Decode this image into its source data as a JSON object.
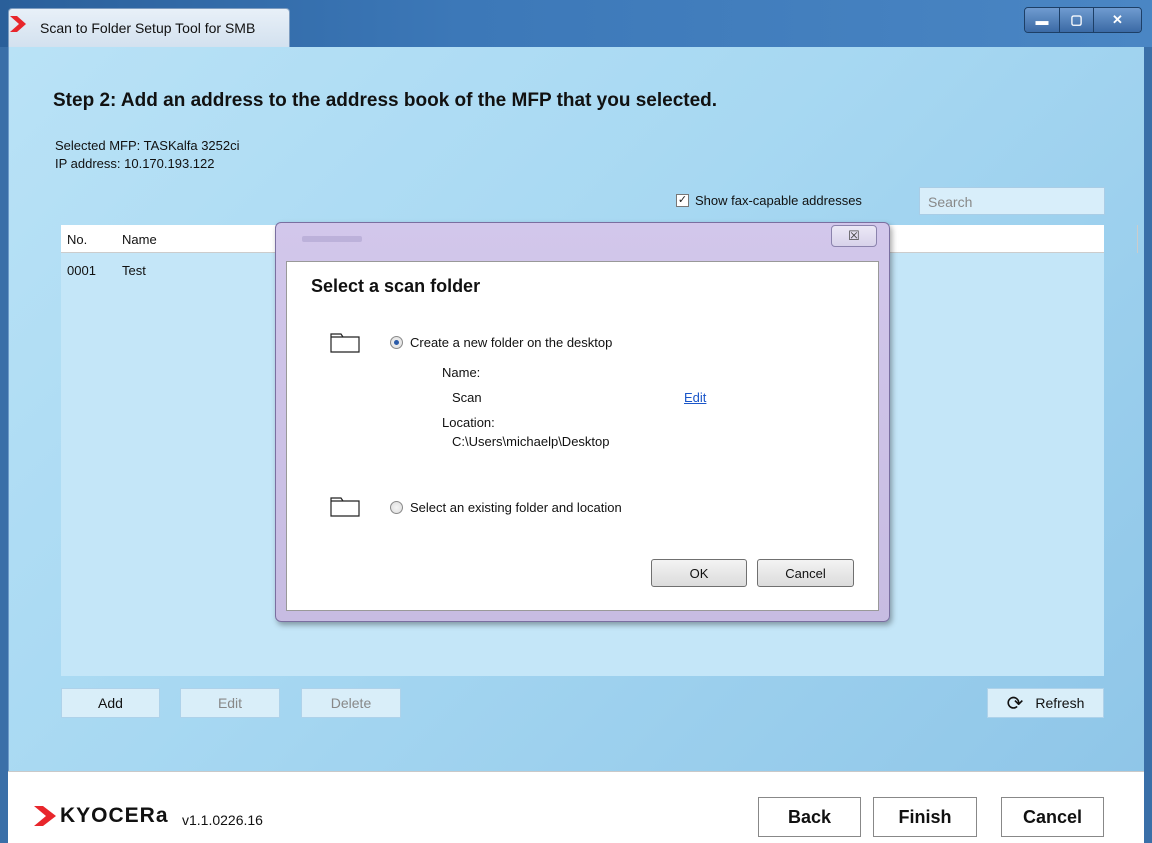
{
  "window": {
    "title": "Scan to Folder Setup Tool for SMB"
  },
  "step": {
    "title": "Step 2: Add an address to the address book of the MFP that you selected.",
    "mfp": "Selected MFP: TASKalfa 3252ci",
    "ip": "IP address: 10.170.193.122"
  },
  "toolbar": {
    "fax_label": "Show fax-capable addresses",
    "fax_checked": "✓",
    "search_placeholder": "Search"
  },
  "list": {
    "columns": [
      "No.",
      "Name"
    ],
    "rows": [
      {
        "no": "0001",
        "name": "Test"
      }
    ]
  },
  "actions": {
    "add": "Add",
    "edit": "Edit",
    "delete": "Delete",
    "refresh": "Refresh"
  },
  "footer": {
    "logo": "KYOCERa",
    "version": "v1.1.0226.16",
    "back": "Back",
    "finish": "Finish",
    "cancel": "Cancel"
  },
  "dialog": {
    "heading": "Select a scan folder",
    "option_new": "Create a new folder on the desktop",
    "name_label": "Name:",
    "name_value": "Scan",
    "edit_link": "Edit",
    "location_label": "Location:",
    "location_value": "C:\\Users\\michaelp\\Desktop",
    "option_existing": "Select an existing folder and location",
    "ok": "OK",
    "cancel": "Cancel",
    "close_glyph": "☒"
  },
  "colors": {
    "accent": "#e8262c",
    "link": "#1a56c9",
    "client_bg": "#a7d8f2"
  }
}
